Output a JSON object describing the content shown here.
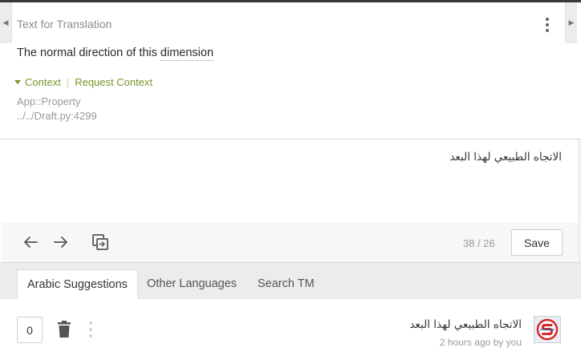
{
  "source": {
    "title": "Text for Translation",
    "text_before": "The normal direction of this ",
    "term": "dimension",
    "context_label": "Context",
    "request_context_label": "Request Context",
    "meta_class": "App::Property",
    "meta_location": "../../Draft.py:4299"
  },
  "editor": {
    "translation_value": "الاتجاه الطبيعي لهذا البعد",
    "counter": "38 / 26",
    "save_label": "Save"
  },
  "tabs": [
    {
      "label": "Arabic Suggestions",
      "active": true
    },
    {
      "label": "Other Languages",
      "active": false
    },
    {
      "label": "Search TM",
      "active": false
    }
  ],
  "suggestion": {
    "votes": "0",
    "text": "الاتجاه الطبيعي لهذا البعد",
    "meta": "2 hours ago by you"
  },
  "colors": {
    "accent_green": "#77962a",
    "avatar_red": "#d9262b",
    "topbar": "#3a3a3a"
  }
}
